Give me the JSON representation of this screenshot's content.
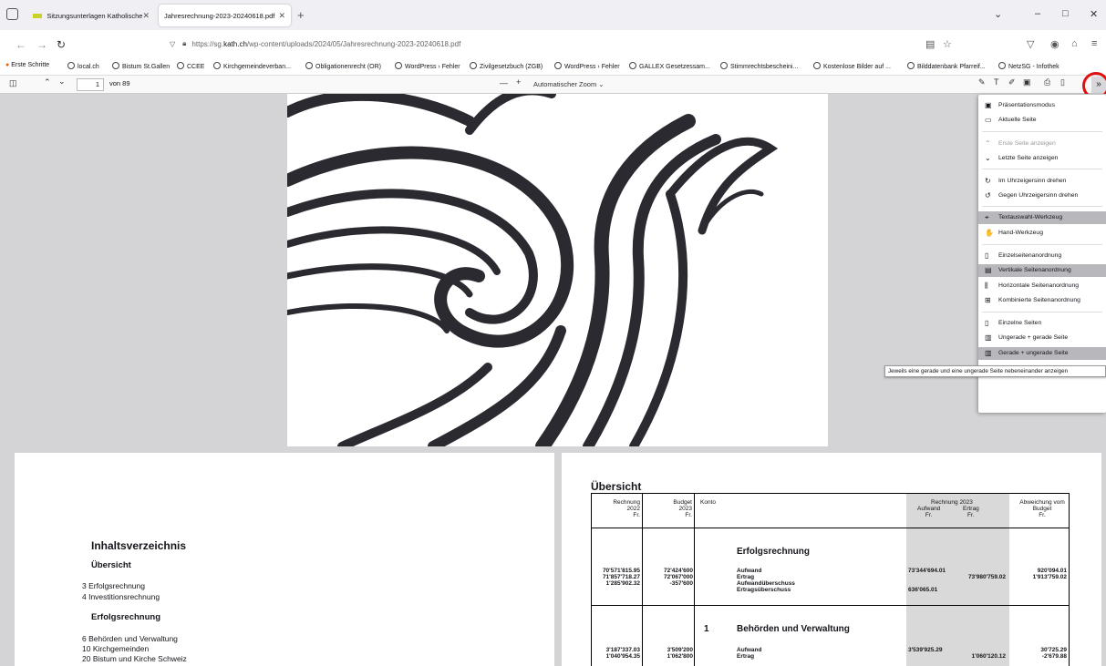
{
  "tabs": [
    {
      "label": "Sitzungsunterlagen Katholische",
      "close": "✕"
    },
    {
      "label": "Jahresrechnung-2023-20240618.pdf",
      "close": "✕"
    }
  ],
  "new_tab": "+",
  "window": {
    "min": "–",
    "max": "□",
    "close": "✕",
    "list": "⌄"
  },
  "url": {
    "prefix": "https://sg.",
    "domain": "kath.ch",
    "path": "/wp-content/uploads/2024/05/Jahresrechnung-2023-20240618.pdf"
  },
  "bookmarks": [
    "Erste Schritte",
    "local.ch",
    "Bistum St.Gallen",
    "CCEE",
    "Kirchgemeindeverban...",
    "Obligationenrecht (OR)",
    "WordPress › Fehler",
    "Zivilgesetzbuch (ZGB)",
    "WordPress › Fehler",
    "GALLEX Gesetzessam...",
    "Stimmrechtsbescheini...",
    "Kostenlose Bilder auf ...",
    "Bilddatenbank Pfarreif...",
    "NetzSG - Infothek"
  ],
  "pdf": {
    "page": "1",
    "of": "von 89",
    "zoom": "Automatischer Zoom",
    "zoom_minus": "—",
    "zoom_plus": "+"
  },
  "menu": [
    {
      "label": "Präsentationsmodus",
      "icon": "▣",
      "state": ""
    },
    {
      "label": "Aktuelle Seite",
      "icon": "▭",
      "state": ""
    },
    {
      "label": "Erste Seite anzeigen",
      "icon": "⌃",
      "state": "dis"
    },
    {
      "label": "Letzte Seite anzeigen",
      "icon": "⌄",
      "state": ""
    },
    {
      "label": "Im Uhrzeigersinn drehen",
      "icon": "↻",
      "state": ""
    },
    {
      "label": "Gegen Uhrzeigersinn drehen",
      "icon": "↺",
      "state": ""
    },
    {
      "label": "Textauswahl-Werkzeug",
      "icon": "⌖",
      "state": "sel"
    },
    {
      "label": "Hand-Werkzeug",
      "icon": "✋",
      "state": ""
    },
    {
      "label": "Einzelseitenanordnung",
      "icon": "▯",
      "state": ""
    },
    {
      "label": "Vertikale Seitenanordnung",
      "icon": "▤",
      "state": "sel"
    },
    {
      "label": "Horizontale Seitenanordnung",
      "icon": "⫼",
      "state": ""
    },
    {
      "label": "Kombinierte Seitenanordnung",
      "icon": "⊞",
      "state": ""
    },
    {
      "label": "Einzelne Seiten",
      "icon": "▯",
      "state": ""
    },
    {
      "label": "Ungerade + gerade Seite",
      "icon": "▥",
      "state": ""
    },
    {
      "label": "Gerade + ungerade Seite",
      "icon": "▥",
      "state": "sel"
    }
  ],
  "tooltip": "Jeweils eine gerade und eine ungerade Seite nebeneinander anzeigen",
  "toc": {
    "title": "Inhaltsverzeichnis",
    "s1": "Übersicht",
    "i1": "3 Erfolgsrechnung",
    "i2": "4 Investitionsrechnung",
    "s2": "Erfolgsrechnung",
    "i3": "6 Behörden und Verwaltung",
    "i4": "10 Kirchgemeinden",
    "i5": "20 Bistum und Kirche Schweiz"
  },
  "overview": {
    "title": "Übersicht",
    "h_rechnung": "Rechnung",
    "h_r_year": "2022",
    "h_budget": "Budget",
    "h_b_year": "2023",
    "h_fr": "Fr.",
    "h_konto": "Konto",
    "h_r2023": "Rechnung 2023",
    "h_aufwand": "Aufwand",
    "h_ertrag": "Ertrag",
    "h_abw": "Abweichung vom",
    "h_abw2": "Budget",
    "sec1": "Erfolgsrechnung",
    "r1": [
      "70'571'815.95",
      "72'424'600",
      "Aufwand",
      "73'344'694.01",
      "",
      "920'094.01"
    ],
    "r2": [
      "71'857'718.27",
      "72'067'000",
      "Ertrag",
      "",
      "73'980'759.02",
      "1'913'759.02"
    ],
    "r3": [
      "",
      "-357'600",
      "Aufwandüberschuss",
      "",
      "",
      ""
    ],
    "r4": [
      "1'285'902.32",
      "",
      "Ertragsüberschuss",
      "636'065.01",
      "",
      ""
    ],
    "sec2num": "1",
    "sec2": "Behörden und Verwaltung",
    "r5": [
      "3'187'337.03",
      "3'509'200",
      "Aufwand",
      "3'539'925.29",
      "",
      "30'725.29"
    ],
    "r6": [
      "1'040'954.35",
      "1'062'800",
      "Ertrag",
      "",
      "1'060'120.12",
      "-2'679.88"
    ]
  }
}
